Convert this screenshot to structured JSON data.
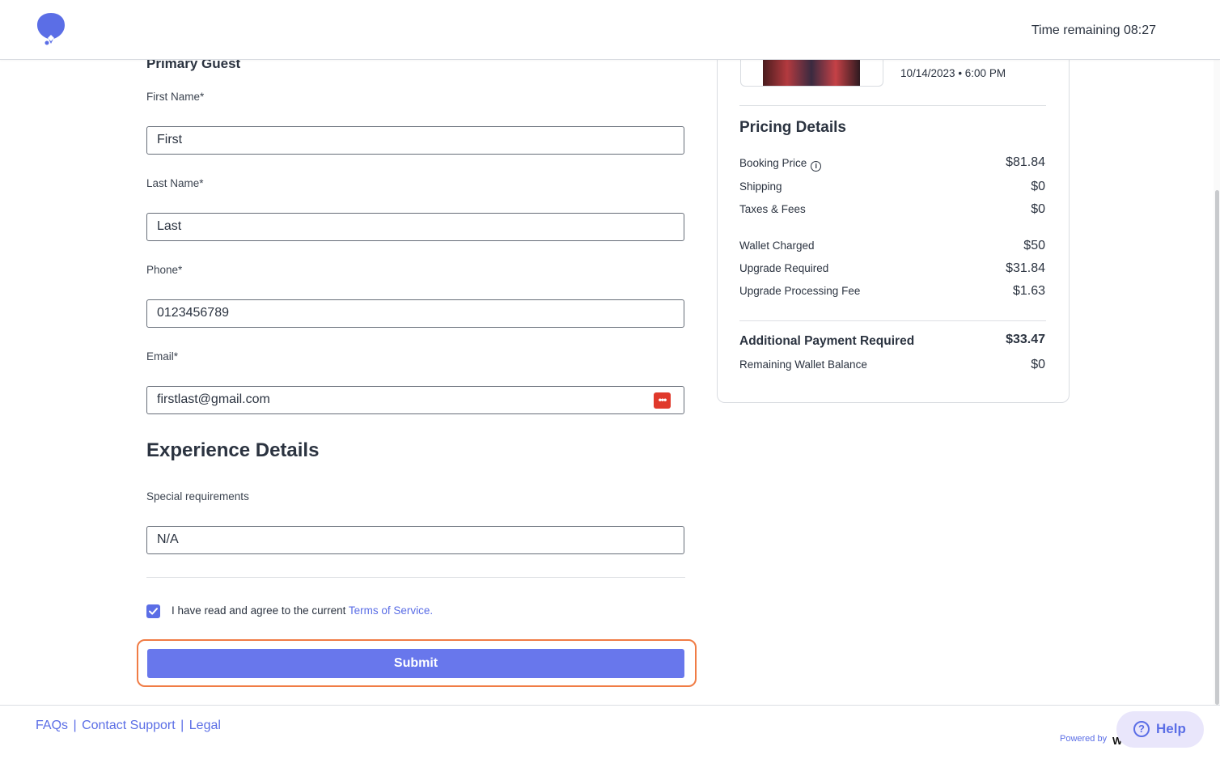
{
  "header": {
    "timer_text": "Time remaining 08:27"
  },
  "form": {
    "section_subtitle": "Primary Guest",
    "first_name": {
      "label": "First Name*",
      "value": "First"
    },
    "last_name": {
      "label": "Last Name*",
      "value": "Last"
    },
    "phone": {
      "label": "Phone*",
      "value": "0123456789"
    },
    "email": {
      "label": "Email*",
      "value": "firstlast@gmail.com",
      "autofill_icon": "password-manager-icon"
    },
    "experience_title": "Experience Details",
    "special": {
      "label": "Special requirements",
      "value": "N/A"
    },
    "terms": {
      "checked": true,
      "prefix": "I have read and agree to the current ",
      "link": "Terms of Service."
    },
    "submit_label": "Submit"
  },
  "summary": {
    "event_date": "10/14/2023 • 6:00 PM",
    "pricing_title": "Pricing Details",
    "rows": [
      {
        "label": "Booking Price",
        "value": "$81.84"
      },
      {
        "label": "Shipping",
        "value": "$0"
      },
      {
        "label": "Taxes & Fees",
        "value": "$0"
      },
      {
        "label": "Wallet Charged",
        "value": "$50"
      },
      {
        "label": "Upgrade Required",
        "value": "$31.84"
      },
      {
        "label": "Upgrade Processing Fee",
        "value": "$1.63"
      }
    ],
    "total": {
      "label": "Additional Payment Required",
      "value": "$33.47"
    },
    "remaining": {
      "label": "Remaining Wallet Balance",
      "value": "$0"
    }
  },
  "footer": {
    "faqs": "FAQs",
    "contact": "Contact Support",
    "legal": "Legal",
    "separator": "|",
    "powered_by": "Powered by",
    "help_label": "Help"
  },
  "colors": {
    "accent": "#6877ec",
    "highlight_outline": "#f07c45"
  }
}
